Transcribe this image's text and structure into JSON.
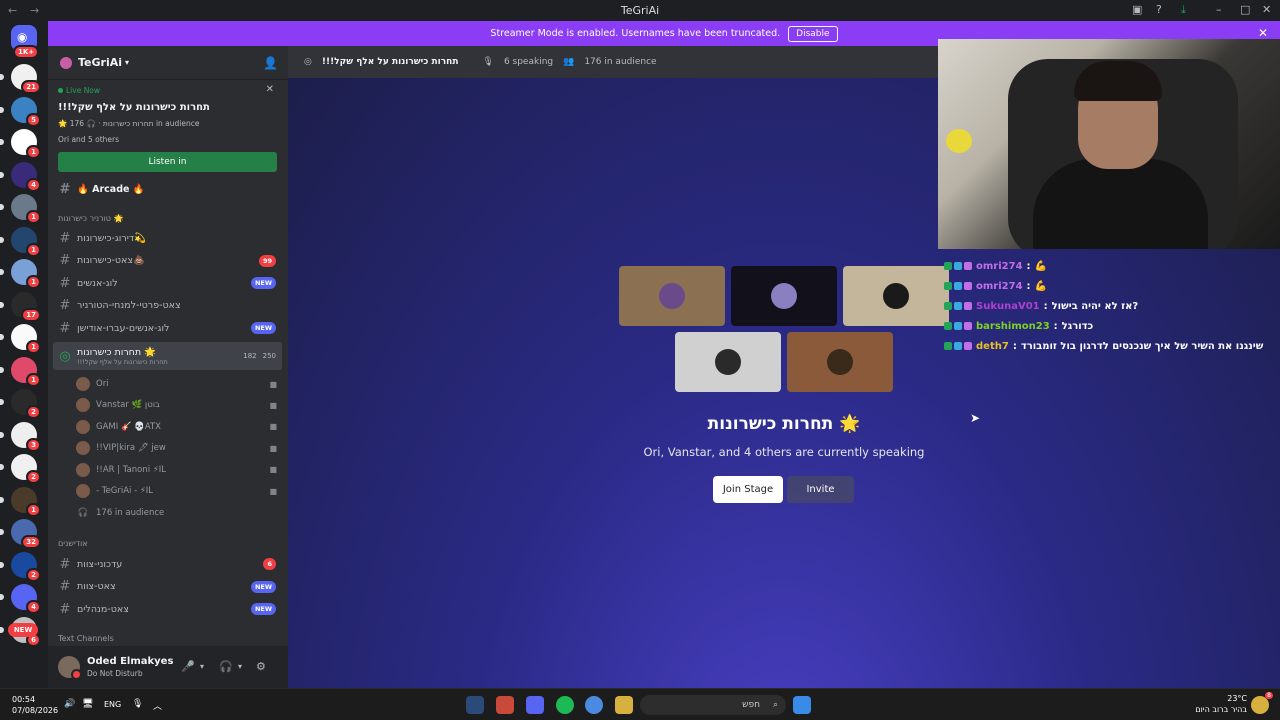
{
  "window": {
    "title": "TeGriAi"
  },
  "banner": {
    "text": "Streamer Mode is enabled. Usernames have been truncated.",
    "disable_label": "Disable"
  },
  "rail": {
    "top_badge": "1K+",
    "servers": [
      {
        "badge": "21",
        "color": "#f0f0f0"
      },
      {
        "badge": "5",
        "color": "#3b82c4"
      },
      {
        "badge": "1",
        "color": "#ffffff"
      },
      {
        "badge": "4",
        "color": "#3a2a7a"
      },
      {
        "badge": "1",
        "color": "#6a7a8a"
      },
      {
        "badge": "1",
        "color": "#23466e"
      },
      {
        "badge": "1",
        "color": "#7aa0d8"
      },
      {
        "badge": "17",
        "color": "#2a2a2a"
      },
      {
        "badge": "1",
        "color": "#fafafa"
      },
      {
        "badge": "1",
        "color": "#e04a6a"
      },
      {
        "badge": "2",
        "color": "#2a2a2a"
      },
      {
        "badge": "3",
        "color": "#eeeeee"
      },
      {
        "badge": "2",
        "color": "#f0f0f0"
      },
      {
        "badge": "1",
        "color": "#4a3a2a"
      },
      {
        "badge": "32",
        "color": "#4a6ab0"
      },
      {
        "badge": "2",
        "color": "#1a4aa0"
      },
      {
        "badge": "4",
        "color": "#5865f2"
      },
      {
        "badge": "6",
        "color": "#c0c0c0"
      }
    ],
    "new_label": "NEW"
  },
  "server": {
    "name": "TeGriAi"
  },
  "live": {
    "status": "Live Now",
    "title": "תחרות כישרונות על אלף שקל!!!",
    "meta": "🌟 תחרות כישרונות · 🎧 176 in audience",
    "others": "Ori and 5 others",
    "listen_label": "Listen in"
  },
  "channels": {
    "arcade": "🔥 Arcade 🔥",
    "cat1": "🌟 טורניר כישרונות",
    "items": [
      {
        "name": "💫דירוג-כישרונות",
        "tag": ""
      },
      {
        "name": "💩צאט-כישרונות",
        "tag": "99"
      },
      {
        "name": "לוג-אנשים",
        "tag": "NEW"
      },
      {
        "name": "צאט-פרטי-למנחי-הטורניר",
        "tag": ""
      },
      {
        "name": "לוג-אנשים-עברו-אודישן",
        "tag": "NEW"
      }
    ],
    "stage": {
      "name": "🌟 תחרות כישרונות",
      "sub": "תחרות כישרונות על אלף שקל!!!",
      "count_a": "182",
      "count_b": "250"
    },
    "speakers": [
      {
        "name": "Ori"
      },
      {
        "name": "𝖵𝖺𝗇𝗌𝗍𝖺𝗋 🌿 בוטן"
      },
      {
        "name": "GAMI 🎸 💀ATX"
      },
      {
        "name": "!!VIP|kira 🖋 jew"
      },
      {
        "name": "!!AR | Tanoni ⚡IL"
      },
      {
        "name": "- TeGriAi - ⚡IL"
      }
    ],
    "audience": "176 in audience",
    "cat2": "אודישנים",
    "items2": [
      {
        "name": "עדכוני-צוות",
        "tag": "6"
      },
      {
        "name": "צאט-צוות",
        "tag": "NEW"
      },
      {
        "name": "צאט-מנהלים",
        "tag": "NEW"
      }
    ],
    "cat3": "Text Channels"
  },
  "user": {
    "name": "Oded Elmakyes",
    "status": "Do Not Disturb"
  },
  "stage_header": {
    "title": "תחרות כישרונות על אלף שקל!!!",
    "speaking": "6 speaking",
    "audience": "176 in audience"
  },
  "stage": {
    "title": "תחרות כישרונות 🌟",
    "subtitle": "Ori, Vanstar, and 4 others are currently speaking",
    "join_label": "Join Stage",
    "invite_label": "Invite",
    "tiles": [
      {
        "bg": "#8c7052",
        "pic": "#6a4a8a"
      },
      {
        "bg": "#12101a",
        "pic": "#8a80c0"
      },
      {
        "bg": "#c4b69a",
        "pic": "#1a1a1a"
      },
      {
        "bg": "#d0d0d0",
        "pic": "#2a2a2a"
      },
      {
        "bg": "#8a5a3a",
        "pic": "#3a2a1a"
      }
    ]
  },
  "chat": [
    {
      "user": "omri274",
      "color": "#c36ee8",
      "msg": "💪"
    },
    {
      "user": "omri274",
      "color": "#c36ee8",
      "msg": "💪"
    },
    {
      "user": "SukunaV01",
      "color": "#b040d0",
      "msg": "?אז לא יהיה בישול"
    },
    {
      "user": "barshimon23",
      "color": "#7ed321",
      "msg": "כדורגל"
    },
    {
      "user": "deth7",
      "color": "#e8c020",
      "msg": "שינגנו את השיר של איך שנכנסים לדרגון בול זומבורד"
    }
  ],
  "taskbar": {
    "time": "00:54",
    "date": "07/08/2026",
    "lang": "ENG",
    "search": "חפש",
    "weather_temp": "23°C",
    "weather_desc": "בהיר ברוב היום",
    "notif": "8"
  }
}
